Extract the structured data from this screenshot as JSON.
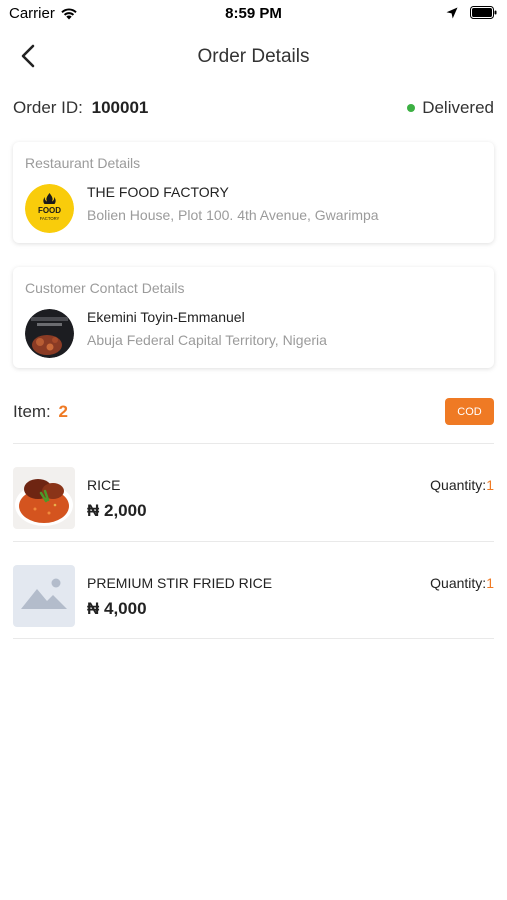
{
  "status_bar": {
    "carrier": "Carrier",
    "time": "8:59 PM"
  },
  "nav": {
    "title": "Order Details"
  },
  "order": {
    "id_label": "Order ID:",
    "id_value": "100001",
    "status": "Delivered",
    "status_color": "#3cb043"
  },
  "restaurant_card": {
    "title": "Restaurant Details",
    "name": "THE FOOD FACTORY",
    "address": "Bolien House, Plot 100. 4th Avenue, Gwarimpa",
    "logo_text": "FOOD",
    "logo_subtext": "FACTORY",
    "logo_color": "#f9cc0b"
  },
  "customer_card": {
    "title": "Customer Contact Details",
    "name": "Ekemini Toyin-Emmanuel",
    "address": "Abuja Federal Capital Territory, Nigeria"
  },
  "items_summary": {
    "label": "Item:",
    "count": "2",
    "payment_badge": "COD",
    "accent_color": "#ef7a24"
  },
  "items": [
    {
      "name": "RICE",
      "price": "₦ 2,000",
      "qty_label": "Quantity:",
      "qty": "1",
      "thumb": "food-photo-icon"
    },
    {
      "name": "PREMIUM STIR FRIED RICE",
      "price": "₦ 4,000",
      "qty_label": "Quantity:",
      "qty": "1",
      "thumb": "image-placeholder-icon"
    }
  ]
}
